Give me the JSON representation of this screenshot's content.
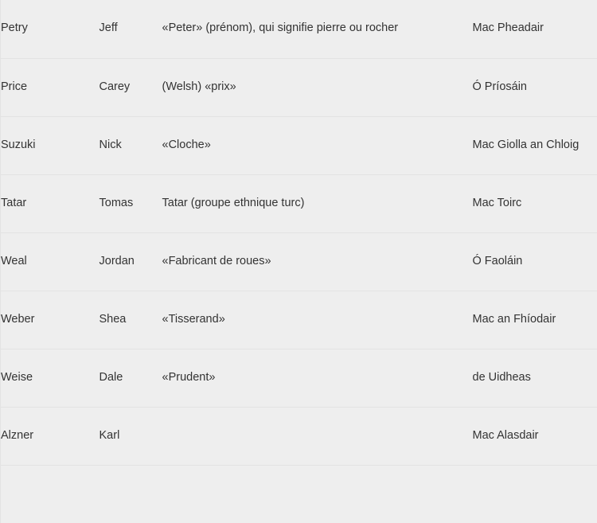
{
  "table": {
    "columns": [
      {
        "key": "surname",
        "name": "surname-column"
      },
      {
        "key": "firstname",
        "name": "firstname-column"
      },
      {
        "key": "meaning",
        "name": "meaning-column"
      },
      {
        "key": "irish",
        "name": "irish-form-column"
      }
    ],
    "rows": [
      {
        "surname": "Petry",
        "firstname": "Jeff",
        "meaning": "«Peter» (prénom), qui signifie pierre ou rocher",
        "irish": "Mac Pheadair"
      },
      {
        "surname": "Price",
        "firstname": "Carey",
        "meaning": "(Welsh) «prix»",
        "irish": "Ó Príosáin"
      },
      {
        "surname": "Suzuki",
        "firstname": "Nick",
        "meaning": "«Cloche»",
        "irish": "Mac Giolla an Chloig"
      },
      {
        "surname": "Tatar",
        "firstname": "Tomas",
        "meaning": "Tatar (groupe ethnique turc)",
        "irish": "Mac Toirc"
      },
      {
        "surname": "Weal",
        "firstname": "Jordan",
        "meaning": "«Fabricant de roues»",
        "irish": "Ó Faoláin"
      },
      {
        "surname": "Weber",
        "firstname": "Shea",
        "meaning": "«Tisserand»",
        "irish": "Mac an Fhíodair"
      },
      {
        "surname": "Weise",
        "firstname": "Dale",
        "meaning": "«Prudent»",
        "irish": "de Uidheas"
      },
      {
        "surname": "Alzner",
        "firstname": "Karl",
        "meaning": "",
        "irish": "Mac Alasdair"
      },
      {
        "surname": "",
        "firstname": "",
        "meaning": "",
        "irish": ""
      }
    ]
  },
  "colors": {
    "background": "#eeeeee",
    "row_separator": "#e3e3e3",
    "text": "#333333"
  }
}
